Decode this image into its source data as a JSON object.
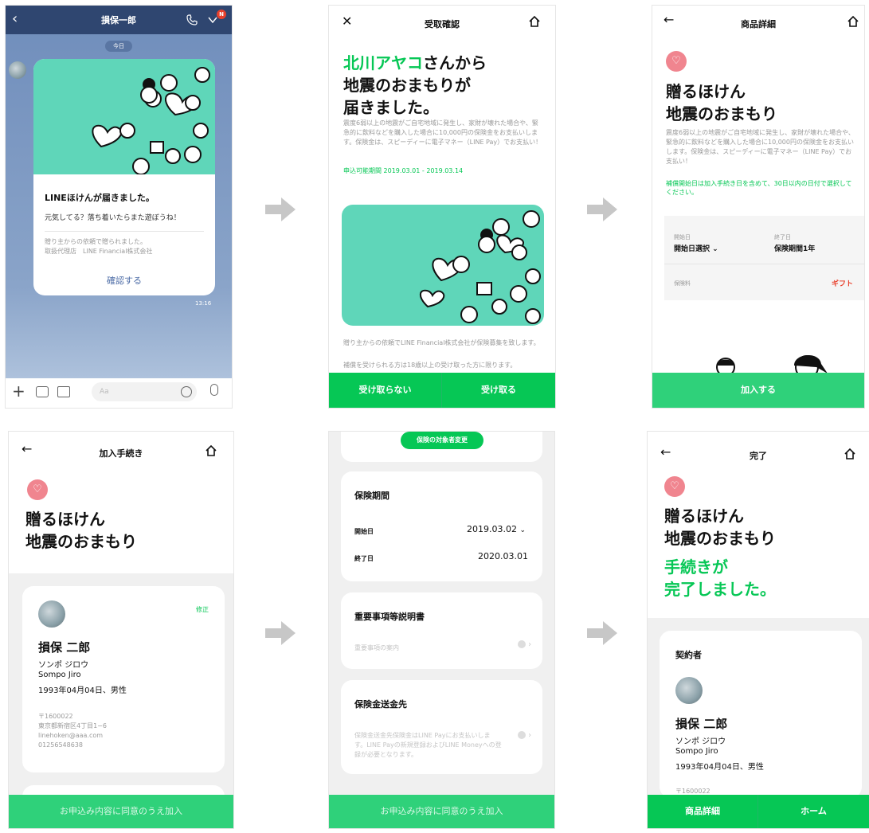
{
  "colors": {
    "brand_green": "#06c755",
    "mint": "#5fd6b9",
    "chat_bg": "#7d97bd",
    "pink": "#f0858f",
    "badge_red": "#e8402c",
    "gift_red": "#e8402c"
  },
  "screen1": {
    "title": "損保一郎",
    "date_chip": "今日",
    "badge": "N",
    "card_title": "LINEほけんが届きました。",
    "card_message": "元気してる？落ち着いたらまた遊ぼうね！",
    "card_meta1": "贈り主からの依頼で贈られました。",
    "card_meta2": "取扱代理店　LINE Financial株式会社",
    "confirm_label": "確認する",
    "time": "13:16",
    "input_placeholder": "Aa",
    "icons": [
      "back-icon",
      "phone-icon",
      "menu-chevron-icon",
      "plus-icon",
      "camera-icon",
      "image-icon",
      "emoji-icon",
      "mic-icon"
    ]
  },
  "screen2": {
    "title": "受取確認",
    "sender": "北川アヤコ",
    "headline_1": "さんから",
    "headline_2": "地震のおまもりが",
    "headline_3": "届きました。",
    "description": "震度6弱以上の地震がご自宅地域に発生し、家財が壊れた場合や、緊急的に飲料などを購入した場合に10,000円の保険金をお支払いします。保険金は、スピーディーに電子マネー（LINE Pay）でお支払い！",
    "period": "申込可能期間  2019.03.01 - 2019.03.14",
    "note1": "贈り主からの依頼でLINE Financial株式会社が保険募集を致します。",
    "note2": "補償を受けられる方は18歳以上の受け取った方に限ります。",
    "decline_label": "受け取らない",
    "accept_label": "受け取る"
  },
  "screen3": {
    "title": "商品詳細",
    "heading_1": "贈るほけん",
    "heading_2": "地震のおまもり",
    "description": "震度6弱以上の地震がご自宅地域に発生し、家財が壊れた場合や、緊急的に飲料などを購入した場合に10,000円の保険金をお支払いします。保険金は、スピーディーに電子マネー（LINE Pay）でお支払い！",
    "notice": "補償開始日は加入手続き日を含めて、30日以内の日付で選択してください。",
    "start_label": "開始日",
    "start_value": "開始日選択",
    "end_label": "終了日",
    "end_value": "保険期間1年",
    "premium_label": "保険料",
    "premium_value": "ギフト",
    "join_label": "加入する"
  },
  "screen4": {
    "title": "加入手続き",
    "heading_1": "贈るほけん",
    "heading_2": "地震のおまもり",
    "edit_label": "修正",
    "name": "損保 二郎",
    "kana": "ソンポ ジロウ",
    "roman": "Sompo Jiro",
    "birth": "1993年04月04日、男性",
    "postal": "〒1600022",
    "address": "東京都新宿区4丁目1−6",
    "email": "linehoken@aaa.com",
    "phone": "01256548638",
    "submit_label": "お申込み内容に同意のうえ加入"
  },
  "screen5": {
    "change_label": "保険の対象者変更",
    "period_title": "保険期間",
    "start_label": "開始日",
    "start_value": "2019.03.02",
    "end_label": "終了日",
    "end_value": "2020.03.01",
    "docs_title": "重要事項等説明書",
    "docs_link": "重要事項の案内",
    "payout_title": "保険金送金先",
    "payout_desc": "保険金送金先保険金はLINE Payにお支払いします。LINE Payの新規登録およびLINE Moneyへの登録が必要となります。",
    "submit_label": "お申込み内容に同意のうえ加入"
  },
  "screen6": {
    "title": "完了",
    "heading_1": "贈るほけん",
    "heading_2": "地震のおまもり",
    "done_1": "手続きが",
    "done_2": "完了しました。",
    "contractor_label": "契約者",
    "name": "損保 二郎",
    "kana": "ソンポ ジロウ",
    "roman": "Sompo Jiro",
    "birth": "1993年04月04日、男性",
    "postal": "〒1600022",
    "product_label": "商品詳細",
    "home_label": "ホーム"
  }
}
